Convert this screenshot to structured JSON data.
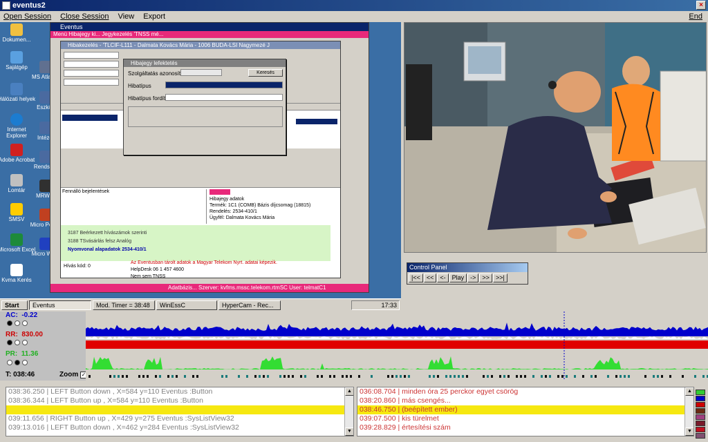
{
  "window": {
    "title": "eventus2",
    "close": "×"
  },
  "menu": {
    "open": "Open Session",
    "close": "Close Session",
    "view": "View",
    "export": "Export",
    "end": "End"
  },
  "desktop": {
    "icons": [
      "Dokumen...",
      "Sajátgép",
      "Hálózati helyek",
      "Internet Explorer",
      "Adobe Acrobat",
      "Lomtár",
      "SMSV",
      "Microsoft Excel",
      "Kvma Kerés"
    ],
    "icons2": [
      "MS Atlantis",
      "Eszköz",
      "Intézet",
      "Rendszer",
      "MRWIN",
      "Micro Power",
      "Micro Word"
    ],
    "main_title": "Eventus",
    "main_pink": "Menü   Hibajegy ki...  Jegykezelés 'TNSS mé...",
    "inner_title": "Hibakezelés - 'TLCIF-L111 - Dalmata Kovács Mária - 1006 BUDA-LSI Nagymezé J",
    "dialog_title": "Hibajegy lefektetés",
    "dialog_f1": "Szolgáltatás azonosító",
    "dialog_f2": "Hibatípus",
    "dialog_f3": "Hibatípus fordítás",
    "dialog_btn": "Keresés",
    "green_1": "3187 Beérkezett hívászámok szerinti",
    "green_2": "3188 TSvásárlás felsz Analóg",
    "green_3": "Nyomvonal alapadatok 2534-410/1",
    "green_4": "Hívás kód: 0",
    "red_note": "Az Eventusban tárolt adatok a Magyar Telekom Nyrt. adatai képezik.",
    "hd_1": "HelpDesk 06 1 457 4600",
    "hd_2": "Nem sem TNSS",
    "pink_foot": "Adatbázis...     Szerver: kvfms.mssc.telekom.rtmSC     User: telmatC1",
    "tree_1": "Hibajegy adatok",
    "tree_2": "Termék: 1C1 (COMB) Bázis díjcsomag (18815)",
    "tree_3": "Rendelés: 2534-410/1",
    "tree_4": "Ügyfél: Dalmata Kovács Mária",
    "fennálló": "Fennálló bejelentések",
    "taskbar": {
      "start": "Start",
      "t1": "Eventus",
      "t2": "Mod. Timer = 38:48",
      "t3": "WinEssC",
      "t4": "HyperCam - Rec...",
      "clock": "17:33"
    }
  },
  "control_panel": {
    "title": "Control Panel",
    "buttons": [
      "|<<",
      "<<",
      "<-",
      "Play",
      "->",
      ">>",
      ">>|"
    ]
  },
  "signals": {
    "ac_label": "AC:",
    "ac_value": "-0.22",
    "rr_label": "RR:",
    "rr_value": "830.00",
    "pr_label": "PR:",
    "pr_value": "11.36",
    "time": "T: 038:46",
    "zoom": "Zoom"
  },
  "log_left": [
    "038:36.250 | LEFT Button down  , X=584 y=110    Eventus :Button",
    "038:36.344 | LEFT Button up    , X=584 y=110    Eventus :Button",
    "",
    "039:11.656 | RIGHT Button up   , X=429 y=275    Eventus :SysListView32",
    "039:13.016 | LEFT Button down  , X=462 y=284    Eventus :SysListView32"
  ],
  "log_right": [
    "036:08.704 |   minden óra 25 perckor egyet csörög",
    "038:20.860 |   más csengés...",
    "038:46.750 |   (beépített ember)",
    "039:07.500 |   kis türelmet",
    "039:28.829 |   értesítési szám"
  ],
  "colors": {
    "accent": "#0a246a",
    "log_highlight": "#f6e811",
    "ac_series": "#0000cc",
    "rr_series": "#e00000",
    "pr_series": "#33dd33"
  },
  "legend_colors": [
    "#33cc33",
    "#0000cc",
    "#cc0000",
    "#6b2a14",
    "#a04080",
    "#7a1a2a",
    "#c01020",
    "#805070"
  ]
}
